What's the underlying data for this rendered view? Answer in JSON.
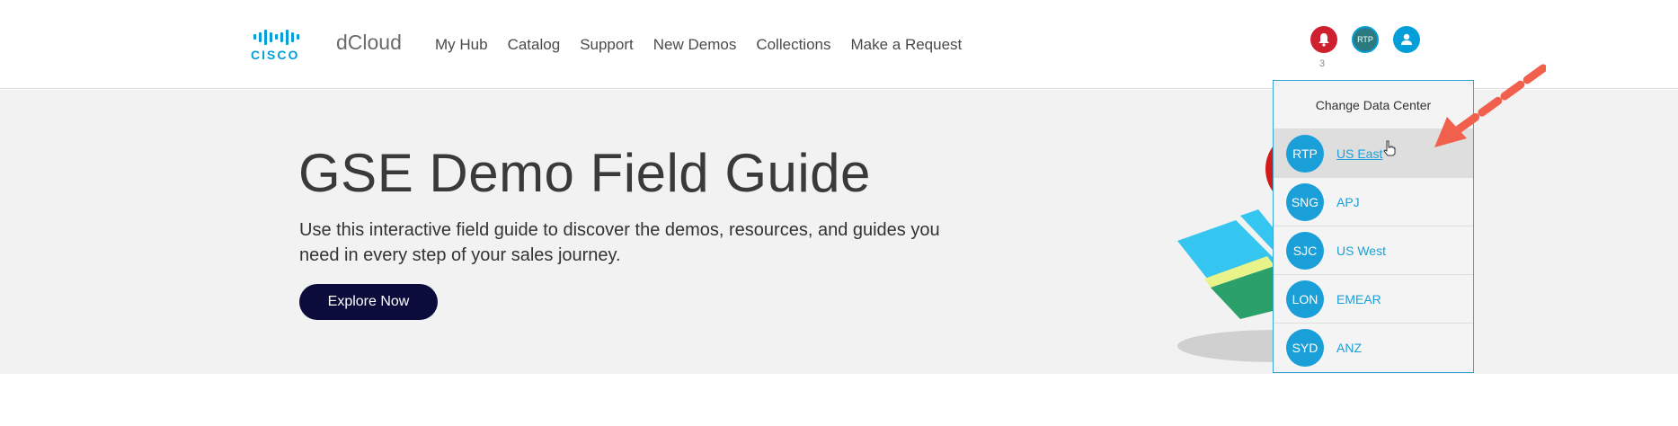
{
  "header": {
    "logo_text": "CISCO",
    "brand": "dCloud",
    "nav": [
      "My Hub",
      "Catalog",
      "Support",
      "New Demos",
      "Collections",
      "Make a Request"
    ],
    "notification_count": "3",
    "datacenter_badge": "RTP"
  },
  "hero": {
    "title": "GSE Demo Field Guide",
    "subtitle": "Use this interactive field guide to discover the demos, resources, and guides you need in every step of your sales journey.",
    "cta": "Explore Now"
  },
  "dropdown": {
    "title": "Change Data Center",
    "items": [
      {
        "code": "RTP",
        "label": "US East"
      },
      {
        "code": "SNG",
        "label": "APJ"
      },
      {
        "code": "SJC",
        "label": "US West"
      },
      {
        "code": "LON",
        "label": "EMEAR"
      },
      {
        "code": "SYD",
        "label": "ANZ"
      }
    ],
    "selected_index": 0
  },
  "colors": {
    "cisco_blue": "#049fd9",
    "bell_red": "#cf2030",
    "cta_navy": "#0c0c3c",
    "arrow": "#f0604d"
  }
}
